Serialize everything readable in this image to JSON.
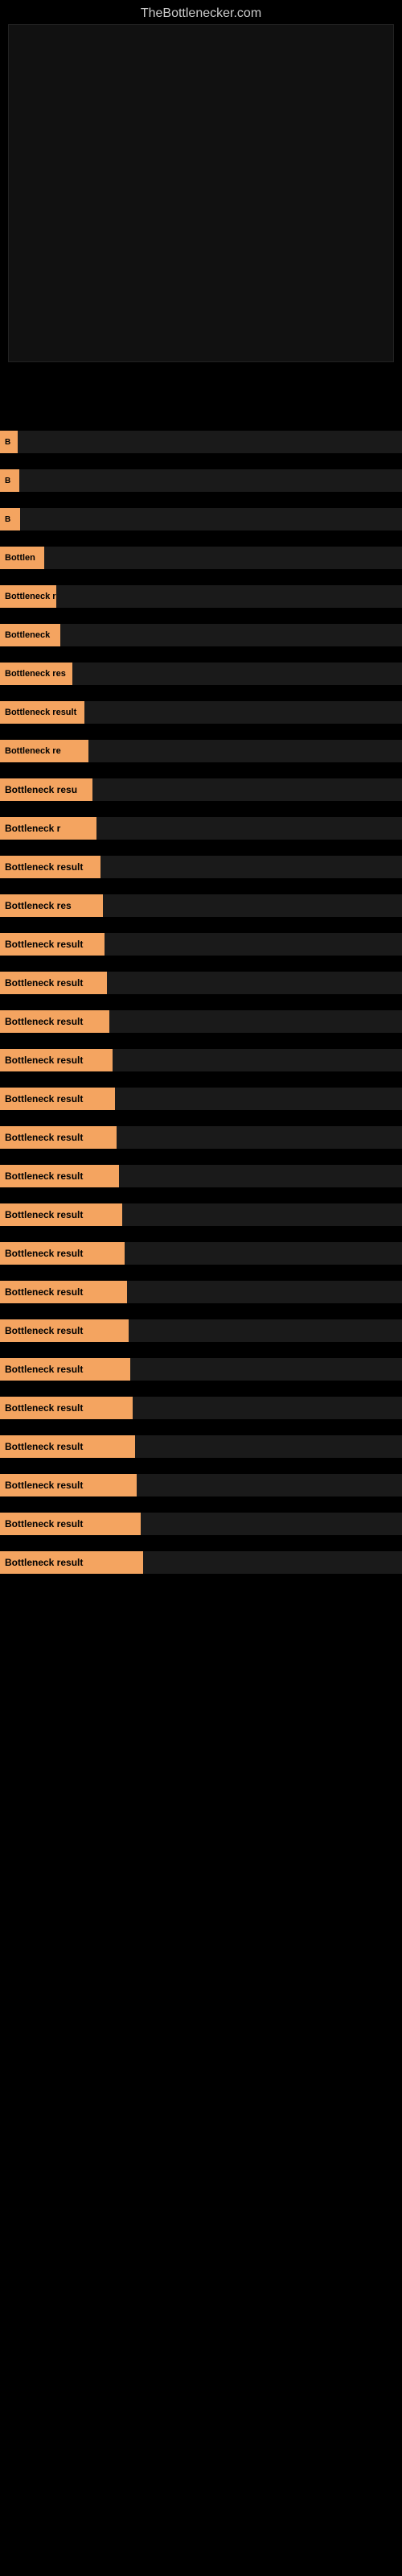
{
  "site": {
    "title": "TheBottlenecker.com"
  },
  "results": [
    {
      "id": 1,
      "label": "B"
    },
    {
      "id": 2,
      "label": "B"
    },
    {
      "id": 3,
      "label": "B"
    },
    {
      "id": 4,
      "label": "Bottlen"
    },
    {
      "id": 5,
      "label": "Bottleneck r"
    },
    {
      "id": 6,
      "label": "Bottleneck"
    },
    {
      "id": 7,
      "label": "Bottleneck res"
    },
    {
      "id": 8,
      "label": "Bottleneck result"
    },
    {
      "id": 9,
      "label": "Bottleneck re"
    },
    {
      "id": 10,
      "label": "Bottleneck resu"
    },
    {
      "id": 11,
      "label": "Bottleneck r"
    },
    {
      "id": 12,
      "label": "Bottleneck result"
    },
    {
      "id": 13,
      "label": "Bottleneck res"
    },
    {
      "id": 14,
      "label": "Bottleneck result"
    },
    {
      "id": 15,
      "label": "Bottleneck result"
    },
    {
      "id": 16,
      "label": "Bottleneck result"
    },
    {
      "id": 17,
      "label": "Bottleneck result"
    },
    {
      "id": 18,
      "label": "Bottleneck result"
    },
    {
      "id": 19,
      "label": "Bottleneck result"
    },
    {
      "id": 20,
      "label": "Bottleneck result"
    },
    {
      "id": 21,
      "label": "Bottleneck result"
    },
    {
      "id": 22,
      "label": "Bottleneck result"
    },
    {
      "id": 23,
      "label": "Bottleneck result"
    },
    {
      "id": 24,
      "label": "Bottleneck result"
    },
    {
      "id": 25,
      "label": "Bottleneck result"
    },
    {
      "id": 26,
      "label": "Bottleneck result"
    },
    {
      "id": 27,
      "label": "Bottleneck result"
    },
    {
      "id": 28,
      "label": "Bottleneck result"
    },
    {
      "id": 29,
      "label": "Bottleneck result"
    },
    {
      "id": 30,
      "label": "Bottleneck result"
    }
  ]
}
